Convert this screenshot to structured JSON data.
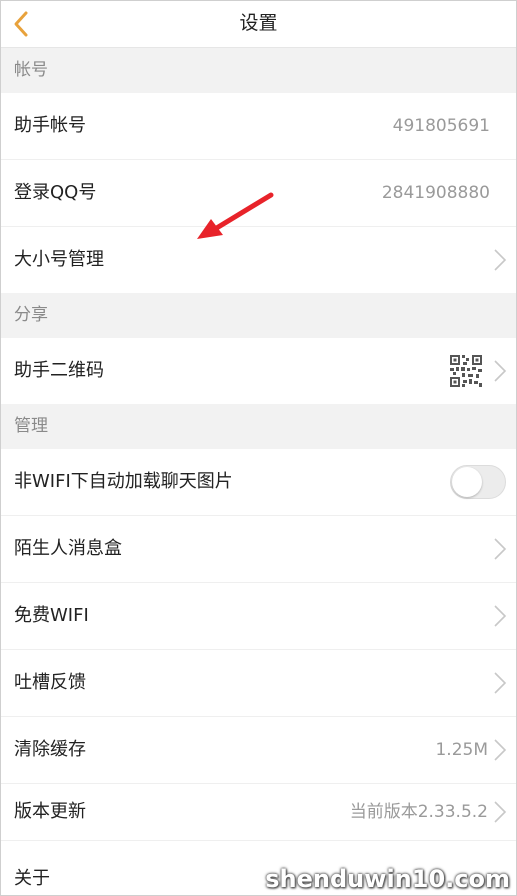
{
  "header": {
    "title": "设置",
    "back_icon": "back-chevron-icon",
    "accent_color": "#e8a23c"
  },
  "sections": {
    "account": "帐号",
    "share": "分享",
    "manage": "管理"
  },
  "rows": {
    "assistant_account": {
      "label": "助手帐号",
      "value": "491805691"
    },
    "login_qq": {
      "label": "登录QQ号",
      "value": "2841908880"
    },
    "account_manage": {
      "label": "大小号管理"
    },
    "assistant_qr": {
      "label": "助手二维码",
      "icon": "qr-code-icon"
    },
    "auto_load_images": {
      "label": "非WIFI下自动加载聊天图片",
      "toggle_on": false
    },
    "stranger_box": {
      "label": "陌生人消息盒"
    },
    "free_wifi": {
      "label": "免费WIFI"
    },
    "feedback": {
      "label": "吐槽反馈"
    },
    "clear_cache": {
      "label": "清除缓存",
      "value": "1.25M"
    },
    "version_update": {
      "label": "版本更新",
      "value": "当前版本2.33.5.2"
    },
    "about": {
      "label": "关于"
    }
  },
  "annotation": {
    "arrow_color": "#e8232a"
  },
  "watermark": {
    "text": "shenduwin10.com"
  }
}
